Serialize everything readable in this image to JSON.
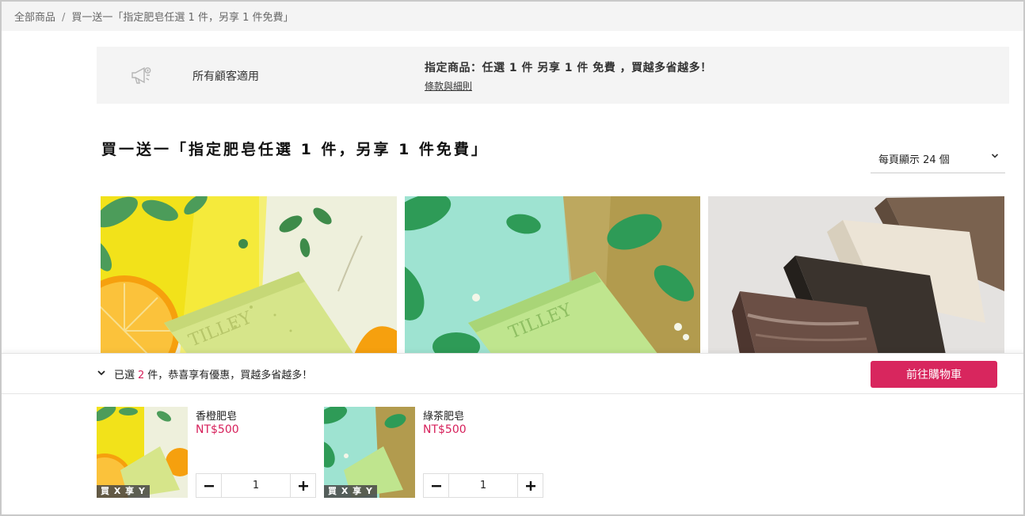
{
  "breadcrumb": {
    "root": "全部商品",
    "separator": "/",
    "current": "買一送一「指定肥皂任選 1 件，另享 1 件免費」"
  },
  "promo": {
    "icon": "megaphone-icon",
    "audience": "所有顧客適用",
    "title": "指定商品：任選 1 件 另享 1 件 免費 ，買越多省越多！",
    "terms_link": "條款與細則"
  },
  "page": {
    "title": "買一送一「指定肥皂任選 1 件，另享 1 件免費」",
    "per_page": "每頁顯示 24 個"
  },
  "products": [
    {
      "image": "orange-soap-photo"
    },
    {
      "image": "green-tea-soap-photo"
    },
    {
      "image": "stacked-soap-bars-photo"
    }
  ],
  "cart_panel": {
    "selected_prefix": "已選",
    "selected_count": "2",
    "selected_suffix": "件，恭喜享有優惠，買越多省越多！",
    "checkout_label": "前往購物車",
    "items": [
      {
        "name": "香橙肥皂",
        "price": "NT$500",
        "quantity": "1",
        "badge": "買 X 享 Y"
      },
      {
        "name": "綠茶肥皂",
        "price": "NT$500",
        "quantity": "1",
        "badge": "買 X 享 Y"
      }
    ]
  },
  "colors": {
    "accent": "#d8265e",
    "price": "#d61f5a",
    "promo_bg": "#f4f4f4"
  }
}
